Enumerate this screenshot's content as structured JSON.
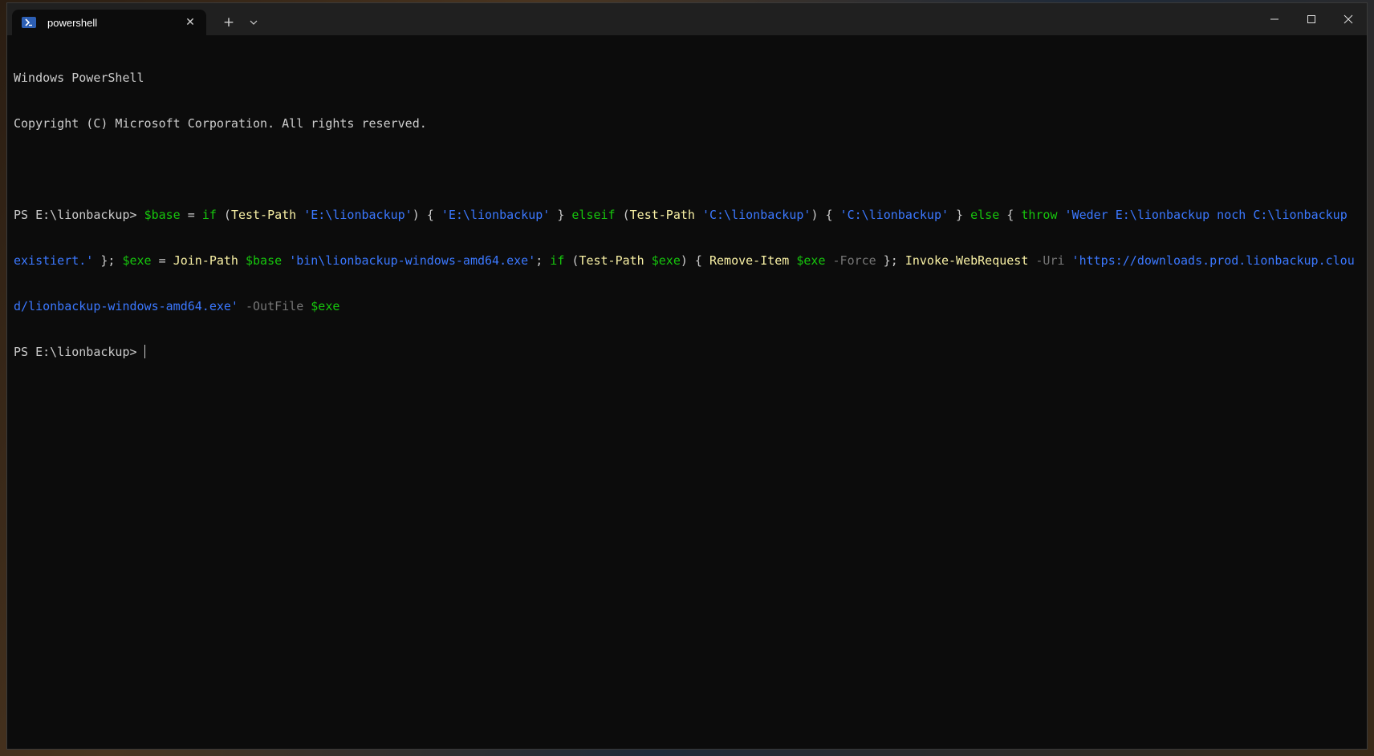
{
  "window": {
    "tab_title": "powershell",
    "tab_close": "✕",
    "new_tab": "+",
    "caption_buttons": [
      "minimize",
      "maximize",
      "close"
    ]
  },
  "terminal": {
    "banner_line1": "Windows PowerShell",
    "banner_line2": "Copyright (C) Microsoft Corporation. All rights reserved.",
    "prompt": "PS E:\\lionbackup>",
    "command": {
      "l1": [
        {
          "t": "w",
          "v": "PS E:\\lionbackup> "
        },
        {
          "t": "var",
          "v": "$base"
        },
        {
          "t": "w",
          "v": " = "
        },
        {
          "t": "kw",
          "v": "if"
        },
        {
          "t": "w",
          "v": " ("
        },
        {
          "t": "cmd",
          "v": "Test-Path"
        },
        {
          "t": "w",
          "v": " "
        },
        {
          "t": "str",
          "v": "'E:\\lionbackup'"
        },
        {
          "t": "w",
          "v": ") { "
        },
        {
          "t": "str",
          "v": "'E:\\lionbackup'"
        },
        {
          "t": "w",
          "v": " } "
        },
        {
          "t": "kw",
          "v": "elseif"
        },
        {
          "t": "w",
          "v": " ("
        },
        {
          "t": "cmd",
          "v": "Test-Path"
        },
        {
          "t": "w",
          "v": " "
        },
        {
          "t": "str",
          "v": "'C:\\lionbackup'"
        },
        {
          "t": "w",
          "v": ") { "
        },
        {
          "t": "str",
          "v": "'C:\\lionbackup'"
        },
        {
          "t": "w",
          "v": " } "
        },
        {
          "t": "kw",
          "v": "else"
        },
        {
          "t": "w",
          "v": " { "
        },
        {
          "t": "kw",
          "v": "throw"
        },
        {
          "t": "w",
          "v": " "
        },
        {
          "t": "str",
          "v": "'Weder E:\\lionbackup noch C:\\lionbackup"
        }
      ],
      "l2": [
        {
          "t": "str",
          "v": "existiert.'"
        },
        {
          "t": "w",
          "v": " }; "
        },
        {
          "t": "var",
          "v": "$exe"
        },
        {
          "t": "w",
          "v": " = "
        },
        {
          "t": "cmd",
          "v": "Join-Path"
        },
        {
          "t": "w",
          "v": " "
        },
        {
          "t": "var",
          "v": "$base"
        },
        {
          "t": "w",
          "v": " "
        },
        {
          "t": "str",
          "v": "'bin\\lionbackup-windows-amd64.exe'"
        },
        {
          "t": "w",
          "v": "; "
        },
        {
          "t": "kw",
          "v": "if"
        },
        {
          "t": "w",
          "v": " ("
        },
        {
          "t": "cmd",
          "v": "Test-Path"
        },
        {
          "t": "w",
          "v": " "
        },
        {
          "t": "var",
          "v": "$exe"
        },
        {
          "t": "w",
          "v": ") { "
        },
        {
          "t": "cmd",
          "v": "Remove-Item"
        },
        {
          "t": "w",
          "v": " "
        },
        {
          "t": "var",
          "v": "$exe"
        },
        {
          "t": "w",
          "v": " "
        },
        {
          "t": "param",
          "v": "-Force"
        },
        {
          "t": "w",
          "v": " }; "
        },
        {
          "t": "cmd",
          "v": "Invoke-WebRequest"
        },
        {
          "t": "w",
          "v": " "
        },
        {
          "t": "param",
          "v": "-Uri"
        },
        {
          "t": "w",
          "v": " "
        },
        {
          "t": "str",
          "v": "'https://downloads.prod.lionbackup.clou"
        }
      ],
      "l3": [
        {
          "t": "str",
          "v": "d/lionbackup-windows-amd64.exe'"
        },
        {
          "t": "w",
          "v": " "
        },
        {
          "t": "param",
          "v": "-OutFile"
        },
        {
          "t": "w",
          "v": " "
        },
        {
          "t": "var",
          "v": "$exe"
        }
      ]
    },
    "prompt_line": "PS E:\\lionbackup> "
  },
  "colors": {
    "background": "#0c0c0c",
    "foreground": "#cccccc",
    "variable": "#16c60c",
    "command": "#f9f1a5",
    "string": "#3b78ff",
    "parameter": "#767676"
  }
}
